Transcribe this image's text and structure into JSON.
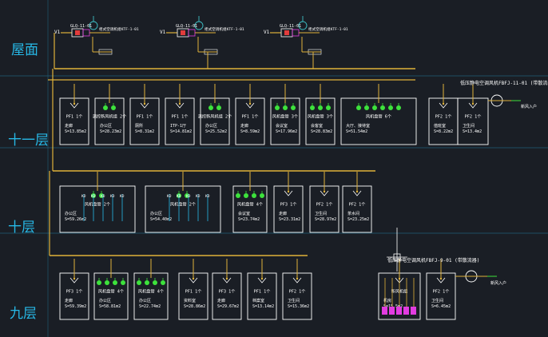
{
  "floors": {
    "roof": "屋面",
    "f11": "十一层",
    "f10": "十层",
    "f9": "九层"
  },
  "roof_units": [
    {
      "tag": "V1",
      "unit": "GLQ-11-01",
      "desc": "柜式空调机组KTF-1-01"
    },
    {
      "tag": "V1",
      "unit": "GLQ-11-01",
      "desc": "柜式空调机组KTF-1-01"
    },
    {
      "tag": "V1",
      "unit": "GLQ-11-01",
      "desc": "柜式空调机组KTF-1-01"
    }
  ],
  "exhaust_fans": [
    {
      "title": "低压静电空调风机FBFJ-11-01 (带散流器)",
      "outlet": "新风入户"
    },
    {
      "title": "低压静电空调风机FBFJ-9-01 (带散流器)",
      "outlet": "新风入户"
    }
  ],
  "boxes_11": [
    {
      "label": "PF1 1个",
      "name": "走廊",
      "area": "S=13.85m2"
    },
    {
      "label": "温控新风机组 2个",
      "name": "办公区",
      "area": "S=28.23m2"
    },
    {
      "label": "PF1 1个",
      "name": "厕所",
      "area": "S=8.31m2"
    },
    {
      "label": "PF1 1个",
      "name": "ITP-1厅",
      "area": "S=14.81m2"
    },
    {
      "label": "温控新风机组 2个",
      "name": "办公区",
      "area": "S=25.52m2"
    },
    {
      "label": "PF1 1个",
      "name": "走廊",
      "area": "S=8.59m2"
    },
    {
      "label": "风机盘管 3个",
      "name": "会议室",
      "area": "S=17.96m2"
    },
    {
      "label": "风机盘管 3个",
      "name": "会客室",
      "area": "S=28.83m2"
    },
    {
      "label": "风机盘管 6个",
      "name": "大厅、接待室",
      "area": "S=51.54m2"
    },
    {
      "label": "PF2 1个",
      "name": "值班室",
      "area": "S=8.22m2"
    },
    {
      "label": "PF2 1个",
      "name": "卫生间",
      "area": "S=13.4m2"
    }
  ],
  "boxes_10": [
    {
      "label": "风机盘管 2个",
      "name": "办公区",
      "area": "S=59.26m2"
    },
    {
      "label": "风机盘管 2个",
      "name": "办公区",
      "area": "S=54.40m2"
    },
    {
      "label": "风机盘管 4个",
      "name": "会议室",
      "area": "S=23.74m2"
    },
    {
      "label": "PF3 1个",
      "name": "走廊",
      "area": "S=23.31m2"
    },
    {
      "label": "PF2 1个",
      "name": "卫生间",
      "area": "S=28.97m2"
    },
    {
      "label": "PF2 1个",
      "name": "茶水间",
      "area": "S=23.25m2"
    }
  ],
  "boxes_9": [
    {
      "label": "PF3 1个",
      "name": "走廊",
      "area": "S=59.39m2"
    },
    {
      "label": "风机盘管 4个",
      "name": "办公区",
      "area": "S=58.81m2"
    },
    {
      "label": "风机盘管 4个",
      "name": "办公区",
      "area": "S=22.74m2"
    },
    {
      "label": "PF1 1个",
      "name": "资料室",
      "area": "S=28.86m2"
    },
    {
      "label": "PF3 1个",
      "name": "走廊",
      "area": "S=29.67m2"
    },
    {
      "label": "PF1 1个",
      "name": "档案室",
      "area": "S=13.14m2"
    },
    {
      "label": "PF2 1个",
      "name": "卫生间",
      "area": "S=15.36m2"
    },
    {
      "label": "新风机组",
      "name": "机房",
      "area": "S=15.5m2"
    },
    {
      "label": "PF2 1个",
      "name": "卫生间",
      "area": "S=6.45m2"
    }
  ],
  "colors": {
    "bg": "#1a1e25",
    "duct": "#e0b23a",
    "box": "#ffffff",
    "fcu": "#3de23c",
    "magenta": "#e23ce0",
    "cyan": "#27b8e6",
    "red": "#e23c3c"
  }
}
